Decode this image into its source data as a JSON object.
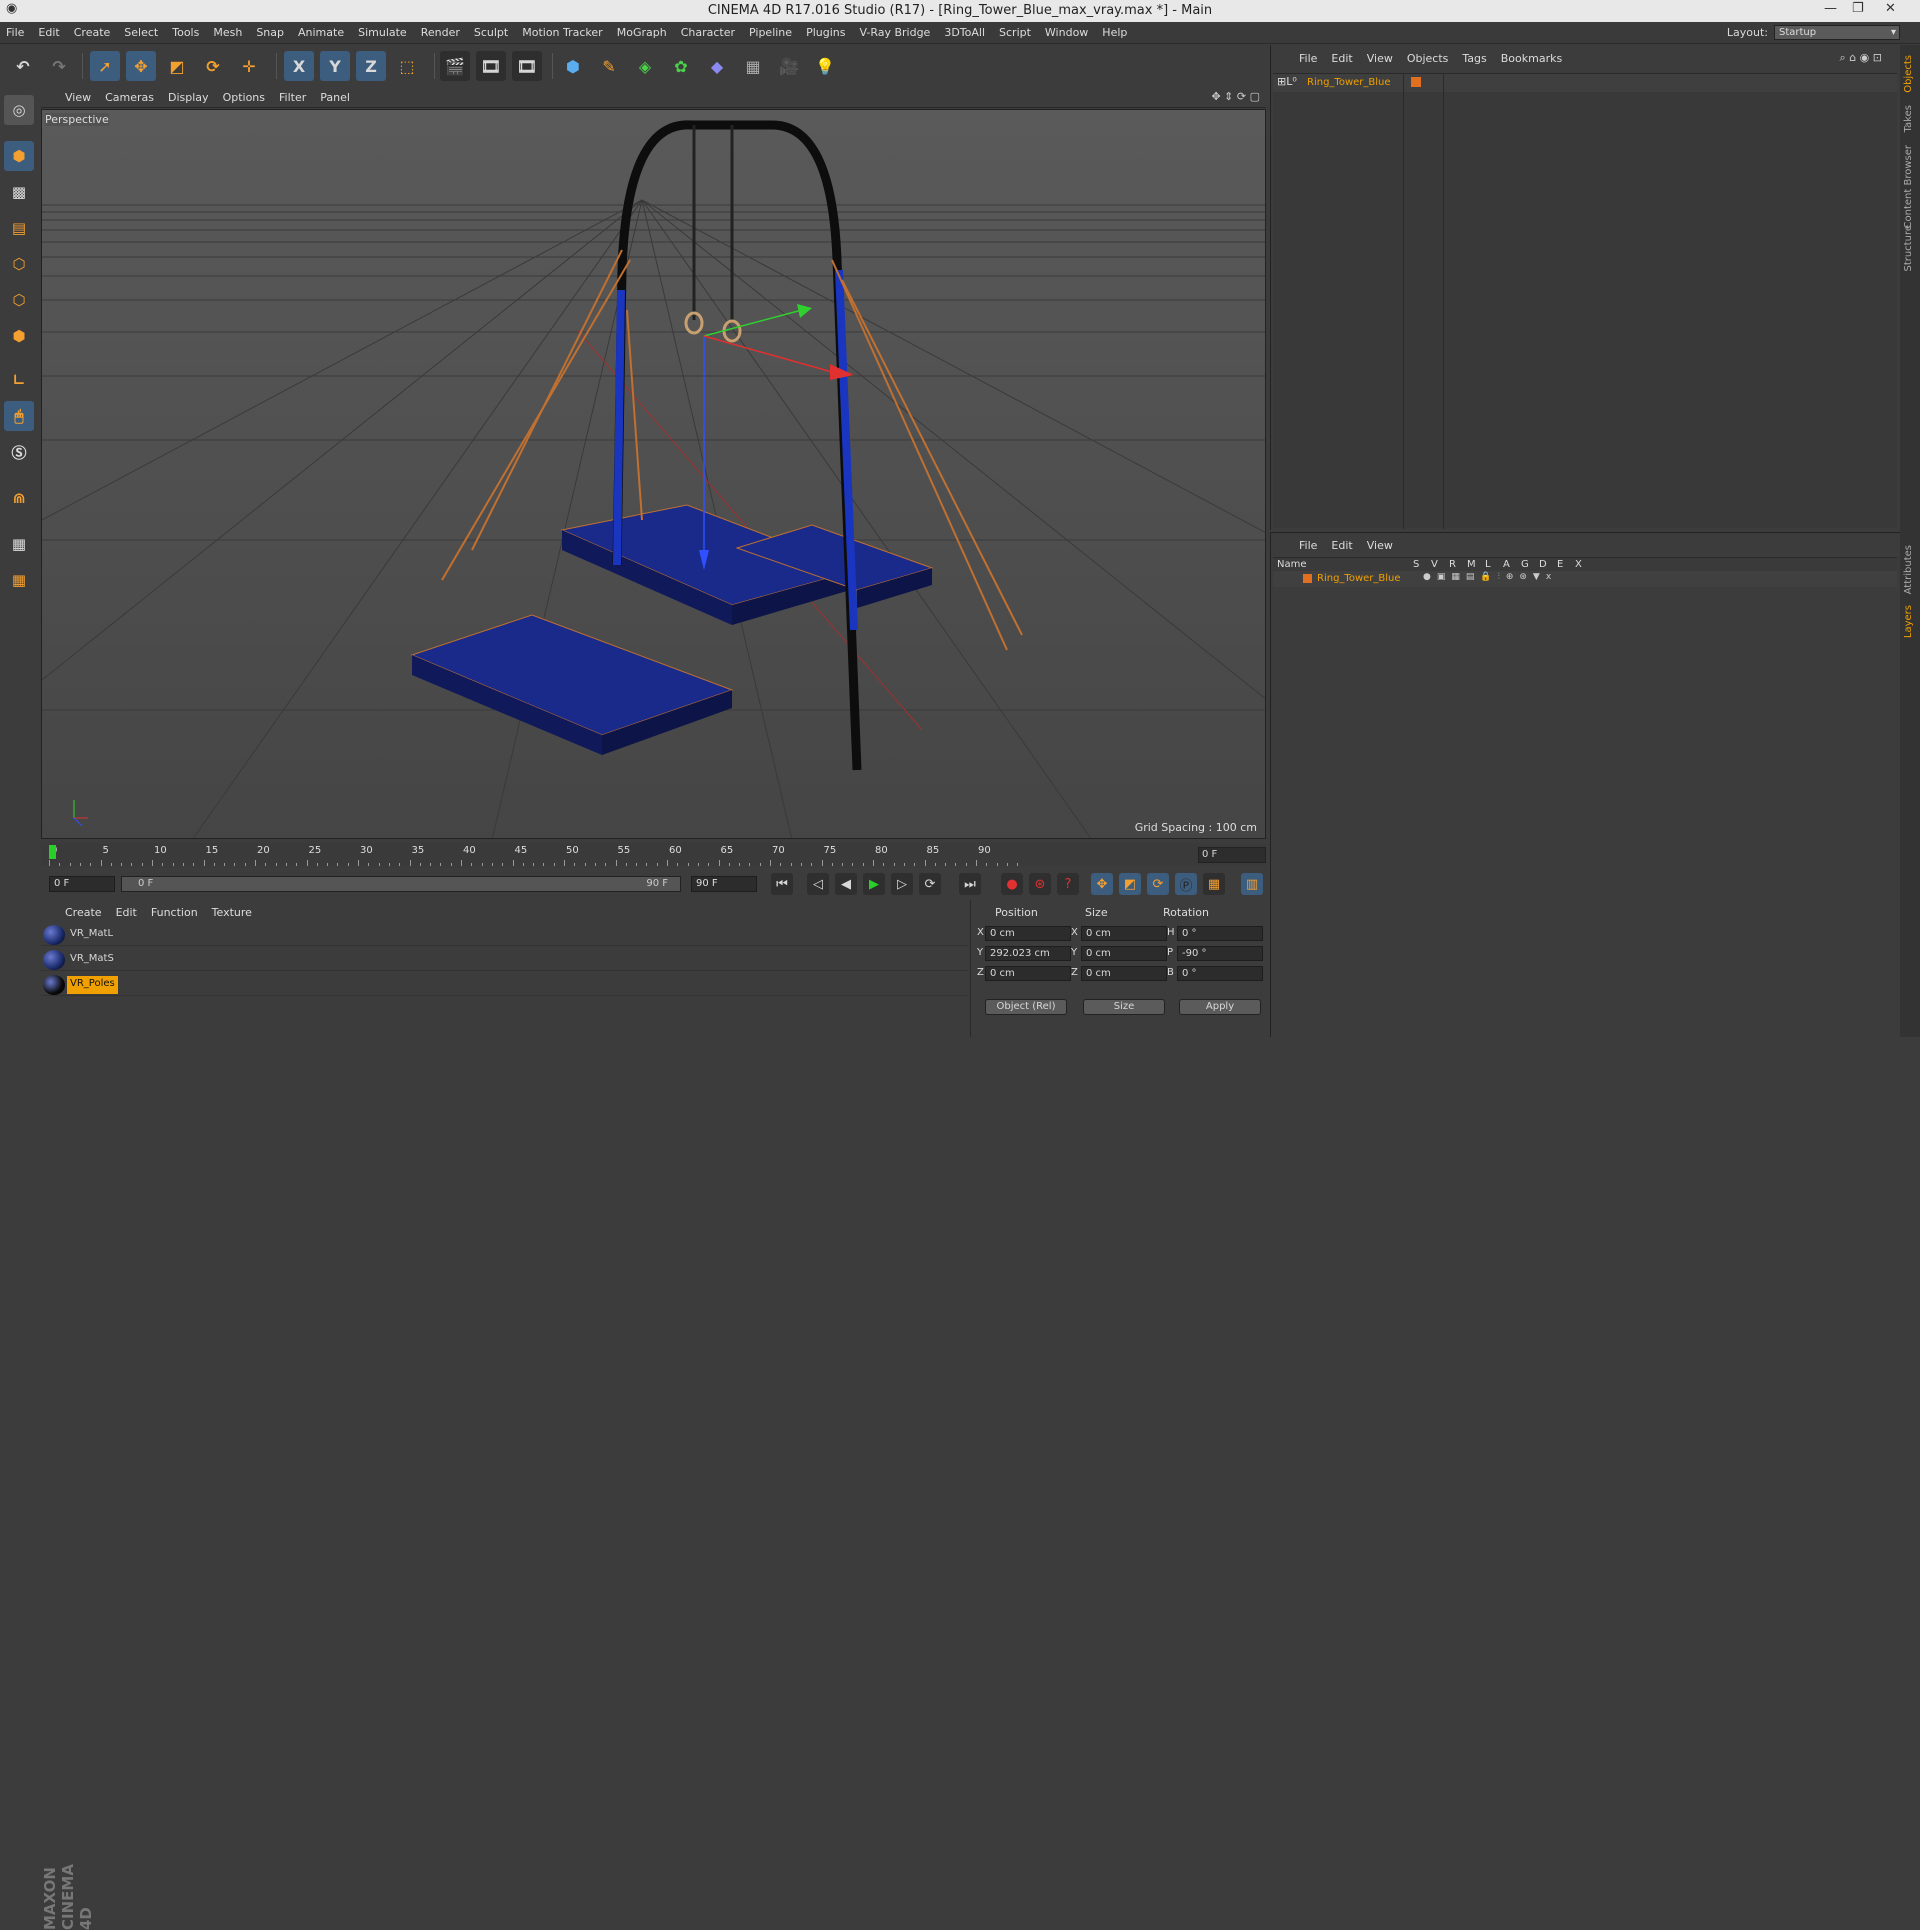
{
  "window": {
    "title": "CINEMA 4D R17.016 Studio (R17) - [Ring_Tower_Blue_max_vray.max *] - Main"
  },
  "menubar": {
    "items": [
      "File",
      "Edit",
      "Create",
      "Select",
      "Tools",
      "Mesh",
      "Snap",
      "Animate",
      "Simulate",
      "Render",
      "Sculpt",
      "Motion Tracker",
      "MoGraph",
      "Character",
      "Pipeline",
      "Plugins",
      "V-Ray Bridge",
      "3DToAll",
      "Script",
      "Window",
      "Help"
    ],
    "layout_label": "Layout:",
    "layout_value": "Startup"
  },
  "toolbar": {
    "axis_labels": [
      "X",
      "Y",
      "Z"
    ]
  },
  "viewport": {
    "menu": [
      "View",
      "Cameras",
      "Display",
      "Options",
      "Filter",
      "Panel"
    ],
    "label": "Perspective",
    "grid_spacing": "Grid Spacing : 100 cm"
  },
  "timeline": {
    "ticks": [
      "0",
      "5",
      "10",
      "15",
      "20",
      "25",
      "30",
      "35",
      "40",
      "45",
      "50",
      "55",
      "60",
      "65",
      "70",
      "75",
      "80",
      "85",
      "90"
    ],
    "current_frame": "0 F",
    "start": "0 F",
    "range_start": "0 F",
    "range_end": "90 F",
    "end": "90 F"
  },
  "materials": {
    "menu": [
      "Create",
      "Edit",
      "Function",
      "Texture"
    ],
    "items": [
      {
        "name": "VR_MatL",
        "color": "#1a2a6a"
      },
      {
        "name": "VR_MatS",
        "color": "#1a2a6a"
      },
      {
        "name": "VR_Poles",
        "color": "#0a0a0a",
        "selected": true
      }
    ]
  },
  "coords": {
    "headers": [
      "Position",
      "Size",
      "Rotation"
    ],
    "rows": [
      {
        "axis": "X",
        "pos": "0 cm",
        "size_axis": "X",
        "size": "0 cm",
        "rot_axis": "H",
        "rot": "0 °"
      },
      {
        "axis": "Y",
        "pos": "292.023 cm",
        "size_axis": "Y",
        "size": "0 cm",
        "rot_axis": "P",
        "rot": "-90 °"
      },
      {
        "axis": "Z",
        "pos": "0 cm",
        "size_axis": "Z",
        "size": "0 cm",
        "rot_axis": "B",
        "rot": "0 °"
      }
    ],
    "mode": "Object (Rel)",
    "size_mode": "Size",
    "apply": "Apply"
  },
  "objects": {
    "menu": [
      "File",
      "Edit",
      "View",
      "Objects",
      "Tags",
      "Bookmarks"
    ],
    "items": [
      {
        "name": "Ring_Tower_Blue",
        "color": "#e07020"
      }
    ]
  },
  "layers": {
    "menu": [
      "File",
      "Edit",
      "View"
    ],
    "columns": [
      "Name",
      "S",
      "V",
      "R",
      "M",
      "L",
      "A",
      "G",
      "D",
      "E",
      "X"
    ],
    "items": [
      {
        "name": "Ring_Tower_Blue",
        "color": "#e07020"
      }
    ]
  },
  "right_tabs": [
    "Objects",
    "Takes",
    "Content Browser",
    "Structure",
    "Attributes",
    "Layers"
  ],
  "brand": "MAXON CINEMA 4D"
}
